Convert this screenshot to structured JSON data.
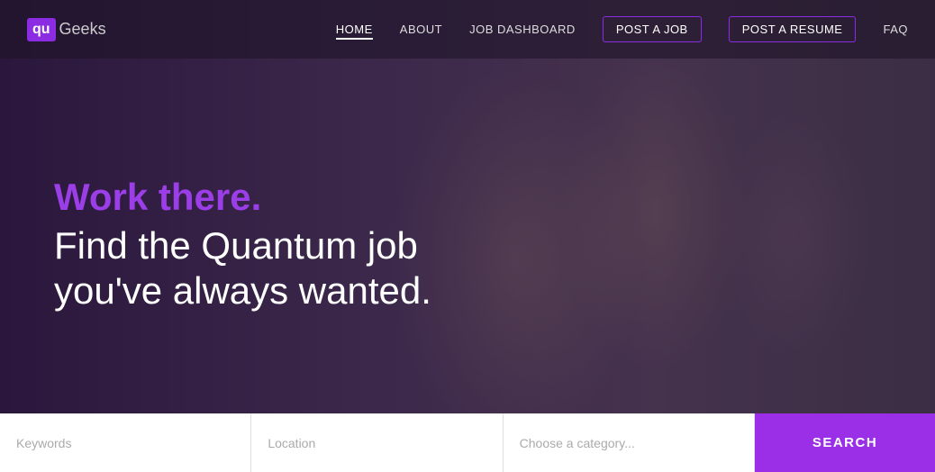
{
  "logo": {
    "box": "qu",
    "text": "Geeks"
  },
  "nav": {
    "links": [
      {
        "id": "home",
        "label": "HOME",
        "active": true,
        "outlined": false
      },
      {
        "id": "about",
        "label": "ABOUT",
        "active": false,
        "outlined": false
      },
      {
        "id": "job-dashboard",
        "label": "JOB DASHBOARD",
        "active": false,
        "outlined": false
      },
      {
        "id": "post-a-job",
        "label": "POST A JOB",
        "active": false,
        "outlined": true
      },
      {
        "id": "post-a-resume",
        "label": "POST A RESUME",
        "active": false,
        "outlined": true
      },
      {
        "id": "faq",
        "label": "FAQ",
        "active": false,
        "outlined": false
      }
    ]
  },
  "hero": {
    "tagline": "Work there.",
    "subtitle_line1": "Find the Quantum job",
    "subtitle_line2": "you've always wanted."
  },
  "search": {
    "keywords_placeholder": "Keywords",
    "location_placeholder": "Location",
    "category_placeholder": "Choose a category...",
    "button_label": "SEARCH"
  }
}
